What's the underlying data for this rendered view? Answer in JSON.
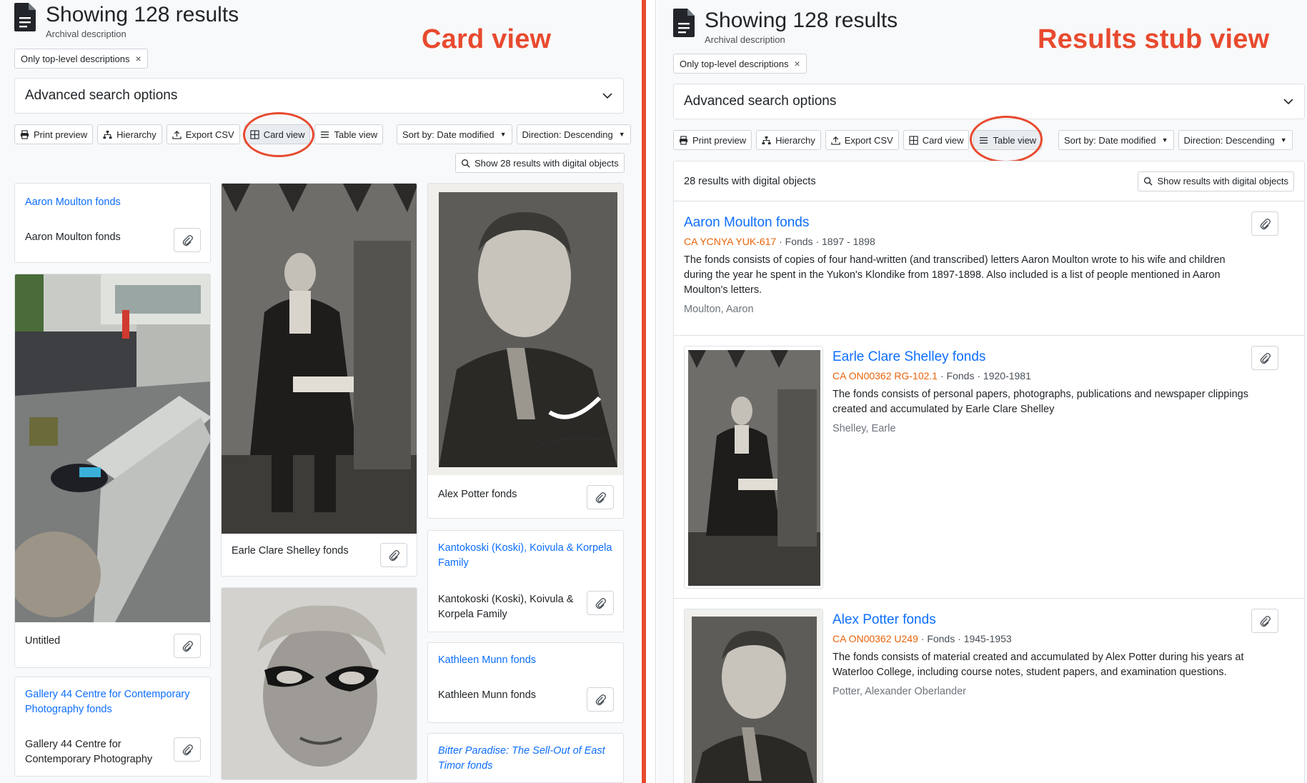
{
  "annotations": {
    "left": "Card view",
    "right": "Results stub view"
  },
  "header": {
    "title": "Showing 128 results",
    "subtitle": "Archival description"
  },
  "filter_chip": {
    "label": "Only top-level descriptions",
    "remove": "×"
  },
  "advanced_search": {
    "label": "Advanced search options"
  },
  "toolbar": {
    "print_preview": "Print preview",
    "hierarchy": "Hierarchy",
    "export_csv": "Export CSV",
    "card_view": "Card view",
    "table_view": "Table view",
    "sort_by": "Sort by: Date modified",
    "direction": "Direction: Descending"
  },
  "card_view": {
    "digital_objects_button": "Show 28 results with digital objects",
    "cards": [
      {
        "link": "Aaron Moulton fonds",
        "text": "Aaron Moulton fonds"
      },
      {
        "text": "Untitled"
      },
      {
        "link": "Gallery 44 Centre for Contemporary Photography fonds",
        "text": "Gallery 44 Centre for Contemporary Photography"
      },
      {
        "text": "Earle Clare Shelley fonds"
      },
      {
        "text": "Alex Potter fonds"
      },
      {
        "link": "Kantokoski (Koski), Koivula & Korpela Family",
        "text": "Kantokoski (Koski), Koivula & Korpela Family"
      },
      {
        "link": "Kathleen Munn fonds",
        "text": "Kathleen Munn fonds"
      },
      {
        "link": "Bitter Paradise: The Sell-Out of East Timor fonds"
      }
    ]
  },
  "stub_view": {
    "count_text": "28 results with digital objects",
    "digital_objects_button": "Show results with digital objects",
    "results": [
      {
        "title": "Aaron Moulton fonds",
        "ref": "CA YCNYA YUK-617",
        "level": "Fonds",
        "dates": "1897 - 1898",
        "description": "The fonds consists of copies of four hand-written (and transcribed) letters Aaron Moulton wrote to his wife and children during the year he spent in the Yukon's Klondike from 1897-1898. Also included is a list of people mentioned in Aaron Moulton's letters.",
        "creator": "Moulton, Aaron"
      },
      {
        "title": "Earle Clare Shelley fonds",
        "ref": "CA ON00362 RG-102.1",
        "level": "Fonds",
        "dates": "1920-1981",
        "description": "The fonds consists of personal papers, photographs, publications and newspaper clippings created and accumulated by Earle Clare Shelley",
        "creator": "Shelley, Earle"
      },
      {
        "title": "Alex Potter fonds",
        "ref": "CA ON00362 U249",
        "level": "Fonds",
        "dates": "1945-1953",
        "description": "The fonds consists of material created and accumulated by Alex Potter during his years at Waterloo College, including course notes, student papers, and examination questions.",
        "creator": "Potter, Alexander Oberlander"
      }
    ],
    "separator": "·"
  },
  "colors": {
    "accent_red": "#e84a2f",
    "link_blue": "#0d6efd",
    "ref_orange": "#e8630a"
  },
  "icons": [
    "document-icon",
    "print-icon",
    "hierarchy-icon",
    "upload-icon",
    "grid-icon",
    "list-icon",
    "search-icon",
    "paperclip-icon",
    "chevron-down-icon"
  ]
}
